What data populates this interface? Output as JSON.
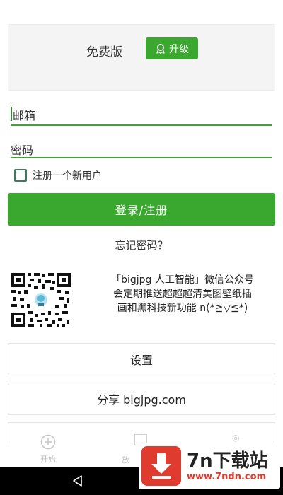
{
  "plan": {
    "label": "免费版",
    "upgrade_label": "升级"
  },
  "form": {
    "email_placeholder": "邮箱",
    "password_placeholder": "密码",
    "register_label": "注册一个新用户",
    "register_checked": false,
    "login_label": "登录/注册",
    "forgot_label": "忘记密码？"
  },
  "promo": {
    "line1": "「bigjpg 人工智能」微信公众号",
    "line2": "会定期推送超超超清美图壁纸插",
    "line3": "画和黑科技新功能 n(*≧▽≦*)"
  },
  "menu": {
    "settings_label": "设置",
    "share_label": "分享 bigjpg.com"
  },
  "tabbar": {
    "start_label": "开始",
    "second_label_partial": "放"
  },
  "watermark": {
    "title": "7n下载站",
    "url": "www.7ndn.com"
  },
  "colors": {
    "accent": "#3aa72e",
    "field_line": "#43a33a",
    "watermark_red": "#e03b2f"
  },
  "icons": {
    "upgrade": "badge-icon",
    "start_tab": "plus-circle-icon",
    "nav_back": "back-triangle-icon",
    "watermark": "download-arrow-icon"
  }
}
